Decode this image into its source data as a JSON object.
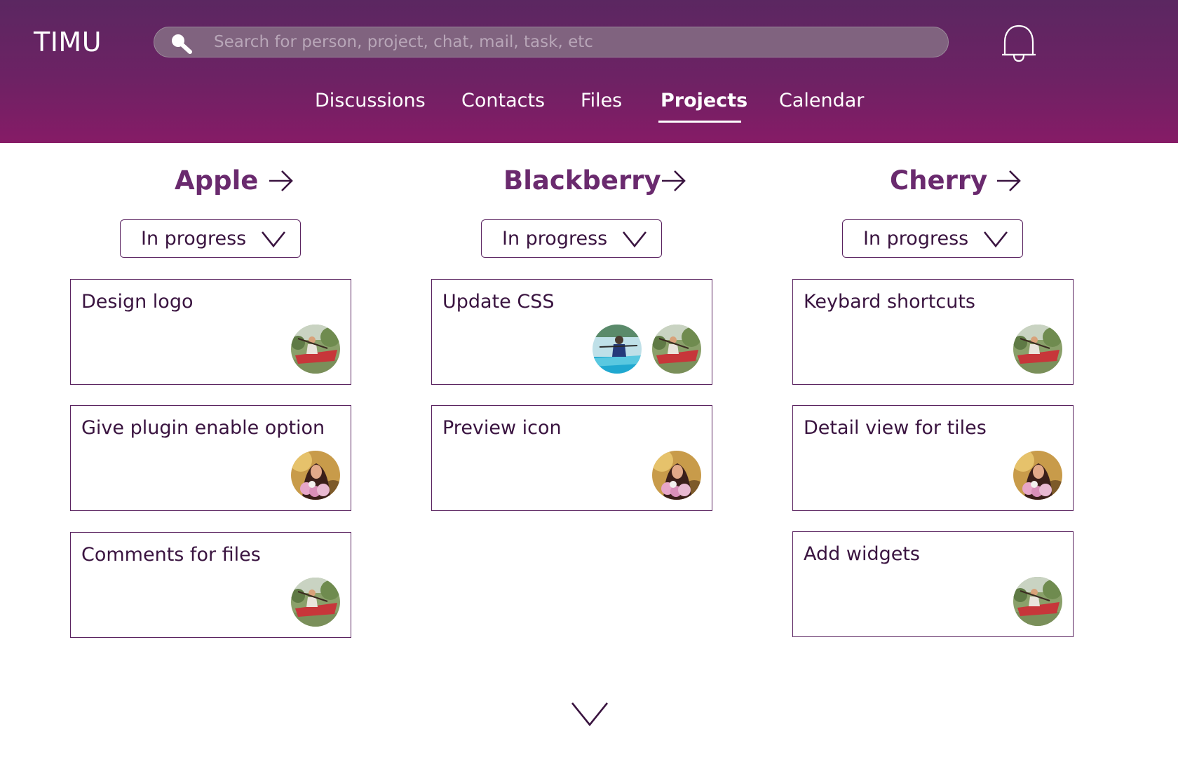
{
  "app": {
    "name": "TIMU"
  },
  "search": {
    "placeholder": "Search for person, project, chat, mail, task, etc",
    "value": ""
  },
  "nav": {
    "tabs": [
      {
        "label": "Discussions",
        "active": false
      },
      {
        "label": "Contacts",
        "active": false
      },
      {
        "label": "Files",
        "active": false
      },
      {
        "label": "Projects",
        "active": true
      },
      {
        "label": "Calendar",
        "active": false
      }
    ]
  },
  "projects": [
    {
      "name": "Apple",
      "status": "In progress",
      "tasks": [
        {
          "title": "Design logo",
          "assignees": [
            "kayak-man"
          ]
        },
        {
          "title": "Give plugin enable option",
          "assignees": [
            "woman-flowers"
          ]
        },
        {
          "title": "Comments for files",
          "assignees": [
            "kayak-man"
          ]
        }
      ]
    },
    {
      "name": "Blackberry",
      "status": "In progress",
      "tasks": [
        {
          "title": "Update CSS",
          "assignees": [
            "woman-boat",
            "kayak-man"
          ]
        },
        {
          "title": "Preview icon",
          "assignees": [
            "woman-flowers"
          ]
        }
      ]
    },
    {
      "name": "Cherry",
      "status": "In progress",
      "tasks": [
        {
          "title": "Keybard shortcuts",
          "assignees": [
            "kayak-man"
          ]
        },
        {
          "title": "Detail view for tiles",
          "assignees": [
            "woman-flowers"
          ]
        },
        {
          "title": "Add widgets",
          "assignees": [
            "kayak-man"
          ]
        }
      ]
    }
  ],
  "icons": {
    "search": "search-icon",
    "notifications": "bell-icon",
    "open_project": "arrow-right-icon",
    "dropdown": "chevron-down-icon",
    "show_more": "chevron-down-icon"
  },
  "colors": {
    "header_top": "#5b2761",
    "header_bottom": "#861b66",
    "accent": "#6a2a6e",
    "border": "#5a2360",
    "text": "#3a1440"
  }
}
